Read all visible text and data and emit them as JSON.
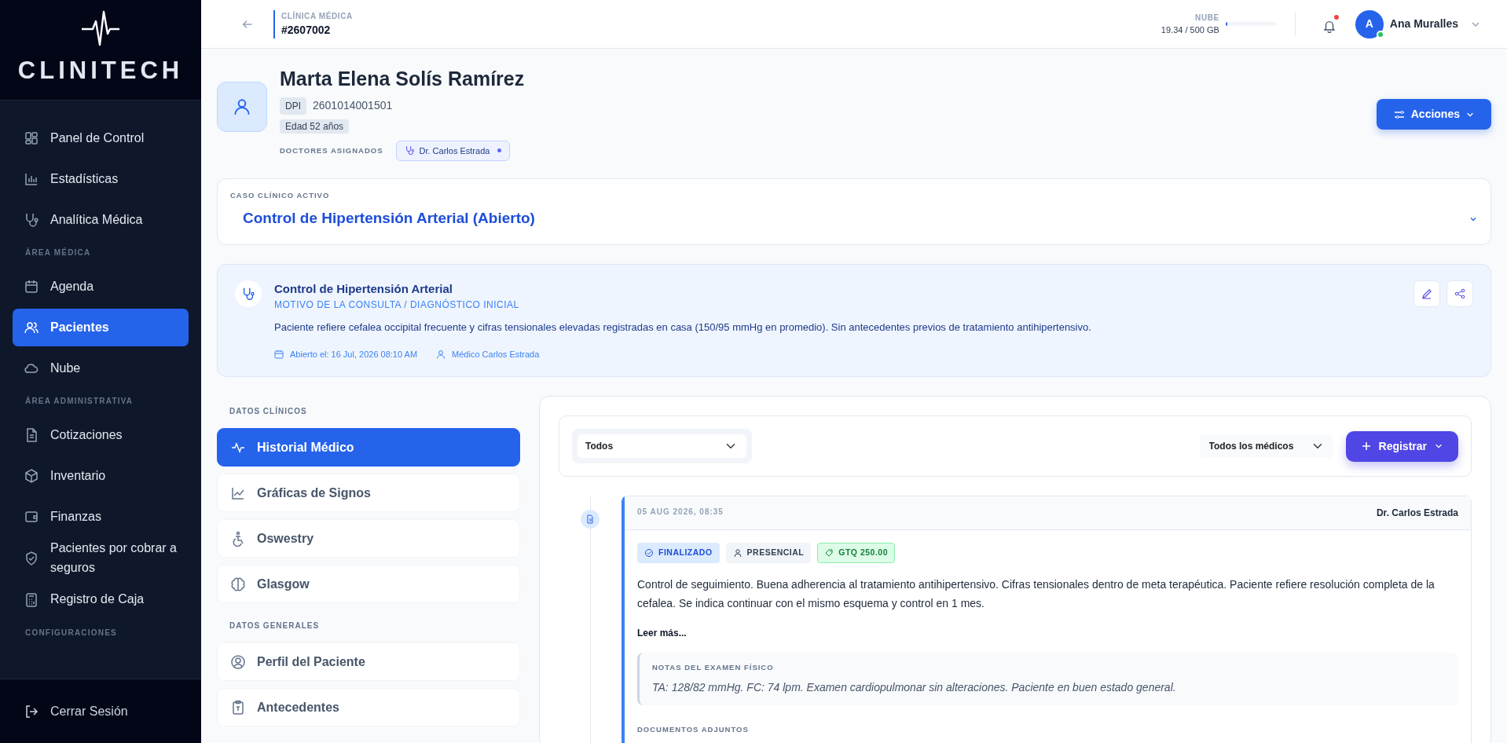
{
  "sidebar": {
    "logo": "CLINITECH",
    "items": [
      {
        "kind": "item",
        "label": "Panel de Control",
        "selected": false
      },
      {
        "kind": "item",
        "label": "Estadísticas",
        "selected": false
      },
      {
        "kind": "item",
        "label": "Analítica Médica",
        "selected": false
      },
      {
        "kind": "section",
        "label": "ÁREA MÉDICA"
      },
      {
        "kind": "item",
        "label": "Agenda",
        "selected": false
      },
      {
        "kind": "item",
        "label": "Pacientes",
        "selected": true
      },
      {
        "kind": "item",
        "label": "Nube",
        "selected": false
      },
      {
        "kind": "section",
        "label": "ÁREA ADMINISTRATIVA"
      },
      {
        "kind": "item",
        "label": "Cotizaciones",
        "selected": false
      },
      {
        "kind": "item",
        "label": "Inventario",
        "selected": false
      },
      {
        "kind": "item",
        "label": "Finanzas",
        "selected": false
      },
      {
        "kind": "item",
        "label": "Pacientes por cobrar a seguros",
        "selected": false
      },
      {
        "kind": "item",
        "label": "Registro de Caja",
        "selected": false
      },
      {
        "kind": "section",
        "label": "CONFIGURACIONES"
      }
    ],
    "logout": "Cerrar Sesión"
  },
  "header": {
    "clinic_label": "CLÍNICA MÉDICA",
    "clinic_id": "#2607002",
    "storage": {
      "label": "NUBE",
      "reading": "19.34 / 500 GB",
      "level": 0.04
    },
    "notifications_unread": true,
    "user_initial": "A",
    "user_online": true,
    "user_name": "Ana Muralles"
  },
  "patient": {
    "name": "Marta Elena Solís Ramírez",
    "id_label": "DPI",
    "id_value": "2601014001501",
    "age": "Edad 52 años",
    "doctors_label": "DOCTORES ASIGNADOS",
    "doctors": [
      "Dr. Carlos Estrada"
    ],
    "actions_button": "Acciones"
  },
  "active_case": {
    "label": "CASO CLÍNICO ACTIVO",
    "value": "Control de Hipertensión Arterial (Abierto)"
  },
  "consult": {
    "title": "Control de Hipertensión Arterial",
    "subtitle": "MOTIVO DE LA CONSULTA / DIAGNÓSTICO INICIAL",
    "text": "Paciente refiere cefalea occipital frecuente y cifras tensionales elevadas registradas en casa (150/95 mmHg en promedio). Sin antecedentes previos de tratamiento antihipertensivo.",
    "opened": "Abierto el: 16 Jul, 2026 08:10 AM",
    "doctor": "Médico Carlos Estrada"
  },
  "side_nav": [
    {
      "kind": "section",
      "label": "DATOS CLÍNICOS"
    },
    {
      "kind": "item",
      "label": "Historial Médico",
      "selected": true
    },
    {
      "kind": "item",
      "label": "Gráficas de Signos",
      "selected": false
    },
    {
      "kind": "item",
      "label": "Oswestry",
      "selected": false
    },
    {
      "kind": "item",
      "label": "Glasgow",
      "selected": false
    },
    {
      "kind": "section",
      "label": "DATOS GENERALES"
    },
    {
      "kind": "item",
      "label": "Perfil del Paciente",
      "selected": false
    },
    {
      "kind": "item",
      "label": "Antecedentes",
      "selected": false
    }
  ],
  "filters": {
    "type_value": "Todos",
    "doctor_value": "Todos los médicos",
    "register_button": "Registrar"
  },
  "timeline": [
    {
      "date": "05 AUG 2026, 08:35",
      "doctor": "Dr. Carlos Estrada",
      "tags": [
        {
          "kind": "status",
          "label": "FINALIZADO"
        },
        {
          "kind": "mode",
          "label": "PRESENCIAL"
        },
        {
          "kind": "amount",
          "label": "GTQ 250.00"
        }
      ],
      "text": "Control de seguimiento. Buena adherencia al tratamiento antihipertensivo. Cifras tensionales dentro de meta terapéutica. Paciente refiere resolución completa de la cefalea. Se indica continuar con el mismo esquema y control en 1 mes.",
      "read_more": "Leer más...",
      "notes_title": "NOTAS DEL EXAMEN FÍSICO",
      "notes": "TA: 128/82 mmHg. FC: 74 lpm. Examen cardiopulmonar sin alteraciones. Paciente en buen estado general.",
      "docs_title": "DOCUMENTOS ADJUNTOS"
    }
  ]
}
